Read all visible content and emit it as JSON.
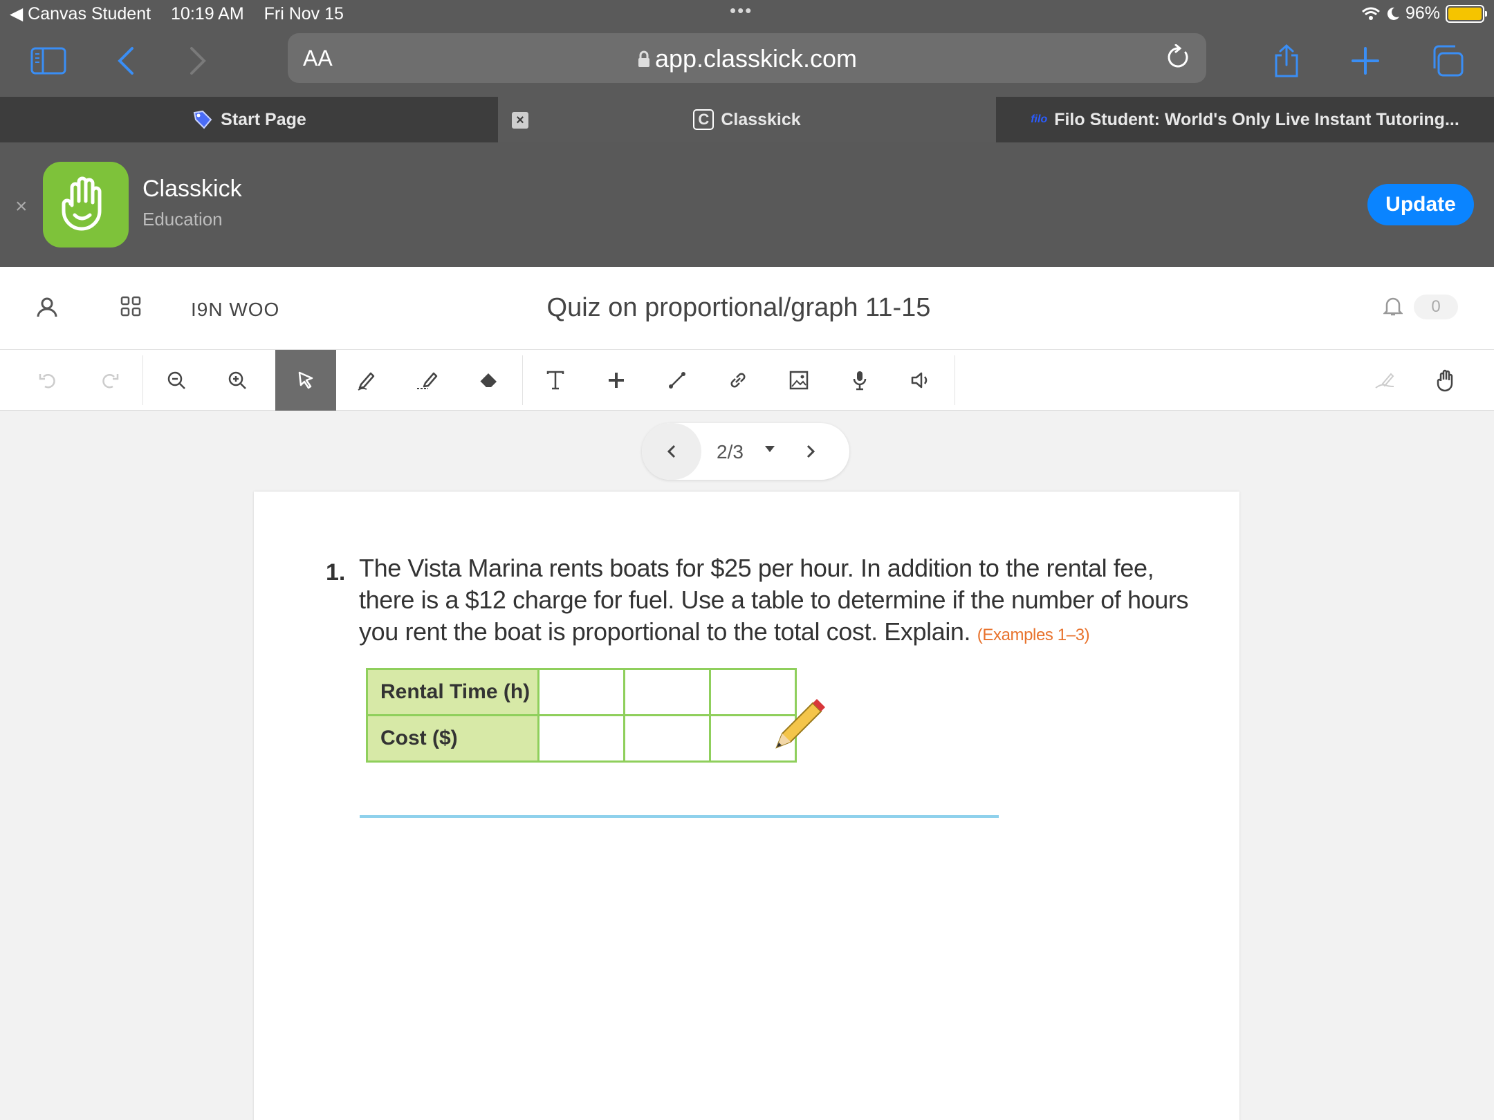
{
  "status_bar": {
    "back_app": "◀ Canvas Student",
    "time": "10:19 AM",
    "date": "Fri Nov 15",
    "dots": "•••",
    "battery": "96%",
    "battery_color": "#f5c400"
  },
  "browser": {
    "text_size_label": "AA",
    "url": "app.classkick.com",
    "icons": [
      "sidebar-icon",
      "back-icon",
      "forward-icon",
      "lock-icon",
      "reload-icon",
      "share-icon",
      "new-tab-icon",
      "tabs-icon"
    ],
    "accent": "#3a8ef5"
  },
  "tabs": [
    {
      "label": "Start Page",
      "icon": "bookmark-icon"
    },
    {
      "label": "Classkick",
      "icon": "classkick-c-icon"
    },
    {
      "label": "Filo Student: World's Only Live Instant Tutoring...",
      "icon": "filo-icon"
    }
  ],
  "banner": {
    "close": "×",
    "app_name": "Classkick",
    "category": "Education",
    "update_label": "Update",
    "icon_color": "#7ec23a",
    "button_color": "#0a84ff"
  },
  "header": {
    "class_code": "I9N WOO",
    "title": "Quiz on proportional/graph 11-15",
    "notification_count": "0"
  },
  "toolbar": {
    "tools": [
      "undo-icon",
      "redo-icon",
      "zoom-out-icon",
      "zoom-in-icon",
      "pointer-icon",
      "pen-icon",
      "highlighter-icon",
      "eraser-icon",
      "text-icon",
      "sticker-plus-icon",
      "line-icon",
      "link-icon",
      "image-icon",
      "microphone-icon",
      "speaker-icon",
      "signature-icon",
      "hand-raise-icon"
    ],
    "selected": "pointer-icon"
  },
  "pager": {
    "label": "2/3"
  },
  "worksheet": {
    "number": "1.",
    "question_lines": [
      "The Vista Marina rents boats for $25 per hour. In addition to the rental fee,",
      "there is a $12 charge for fuel. Use a table to determine if the number of hours",
      "you rent the boat is proportional to the total cost. Explain."
    ],
    "reference": "(Examples 1–3)",
    "table": {
      "rows": [
        "Rental Time (h)",
        "Cost ($)"
      ],
      "empty_cells_per_row": 3
    }
  }
}
